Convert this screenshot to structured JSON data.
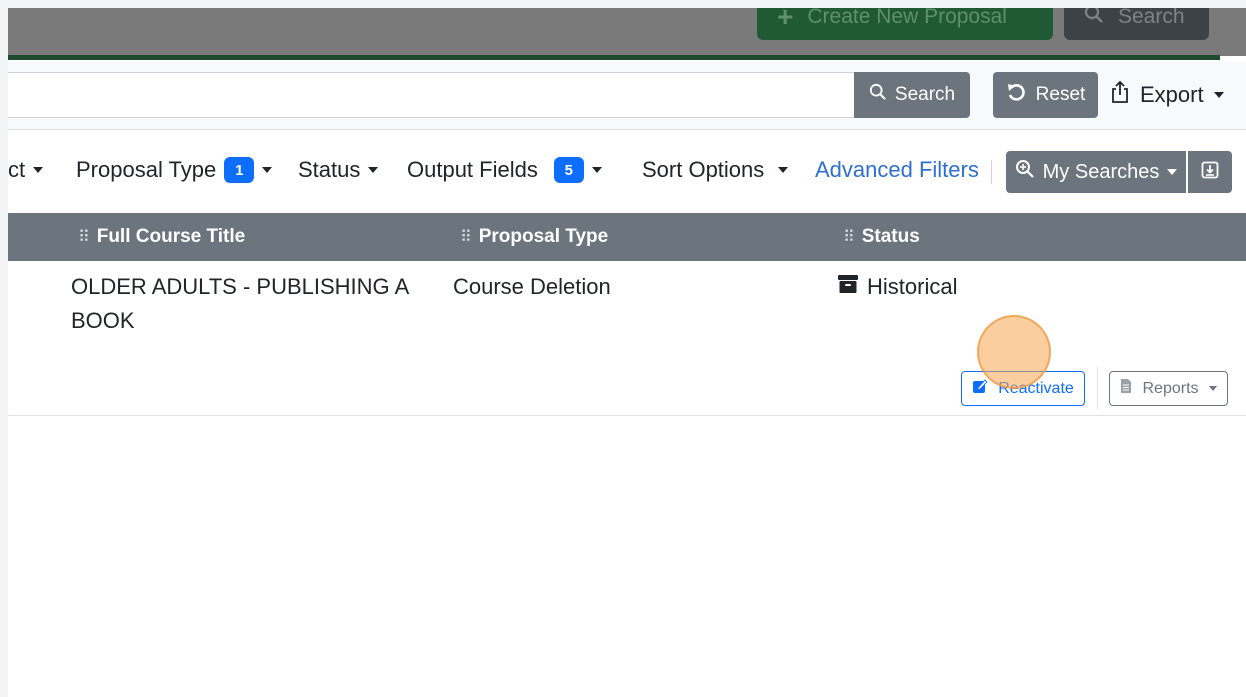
{
  "header": {
    "create_label": "Create New Proposal",
    "search_label": "Search"
  },
  "search_row": {
    "input_value": "",
    "search_label": "Search",
    "reset_label": "Reset",
    "export_label": "Export"
  },
  "filters": {
    "subject_partial": "ct",
    "proposal_type_label": "Proposal Type",
    "proposal_type_count": "1",
    "status_label": "Status",
    "output_fields_label": "Output Fields",
    "output_fields_count": "5",
    "sort_options_label": "Sort Options",
    "advanced_filters_label": "Advanced Filters",
    "my_searches_label": "My Searches"
  },
  "table": {
    "columns": {
      "title": "Full Course Title",
      "type": "Proposal Type",
      "status": "Status"
    },
    "rows": [
      {
        "title": "OLDER ADULTS - PUBLISHING A BOOK",
        "type": "Course Deletion",
        "status": "Historical",
        "reactivate_label": "Reactivate",
        "reports_label": "Reports"
      }
    ]
  },
  "colors": {
    "primary": "#0d6efd",
    "secondary": "#6c757d",
    "link": "#2f6fd0",
    "click_indicator": "#f5a650"
  }
}
